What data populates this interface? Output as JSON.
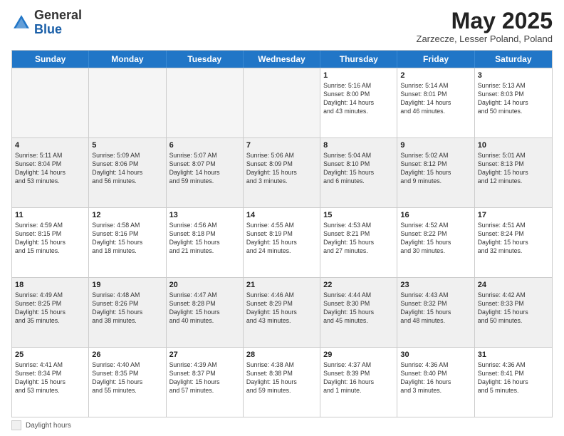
{
  "header": {
    "logo_line1": "General",
    "logo_line2": "Blue",
    "month": "May 2025",
    "location": "Zarzecze, Lesser Poland, Poland"
  },
  "weekdays": [
    "Sunday",
    "Monday",
    "Tuesday",
    "Wednesday",
    "Thursday",
    "Friday",
    "Saturday"
  ],
  "footer": {
    "shaded_label": "Daylight hours"
  },
  "rows": [
    [
      {
        "day": "",
        "text": "",
        "empty": true
      },
      {
        "day": "",
        "text": "",
        "empty": true
      },
      {
        "day": "",
        "text": "",
        "empty": true
      },
      {
        "day": "",
        "text": "",
        "empty": true
      },
      {
        "day": "1",
        "text": "Sunrise: 5:16 AM\nSunset: 8:00 PM\nDaylight: 14 hours\nand 43 minutes.",
        "shaded": false
      },
      {
        "day": "2",
        "text": "Sunrise: 5:14 AM\nSunset: 8:01 PM\nDaylight: 14 hours\nand 46 minutes.",
        "shaded": false
      },
      {
        "day": "3",
        "text": "Sunrise: 5:13 AM\nSunset: 8:03 PM\nDaylight: 14 hours\nand 50 minutes.",
        "shaded": false
      }
    ],
    [
      {
        "day": "4",
        "text": "Sunrise: 5:11 AM\nSunset: 8:04 PM\nDaylight: 14 hours\nand 53 minutes.",
        "shaded": true
      },
      {
        "day": "5",
        "text": "Sunrise: 5:09 AM\nSunset: 8:06 PM\nDaylight: 14 hours\nand 56 minutes.",
        "shaded": true
      },
      {
        "day": "6",
        "text": "Sunrise: 5:07 AM\nSunset: 8:07 PM\nDaylight: 14 hours\nand 59 minutes.",
        "shaded": true
      },
      {
        "day": "7",
        "text": "Sunrise: 5:06 AM\nSunset: 8:09 PM\nDaylight: 15 hours\nand 3 minutes.",
        "shaded": true
      },
      {
        "day": "8",
        "text": "Sunrise: 5:04 AM\nSunset: 8:10 PM\nDaylight: 15 hours\nand 6 minutes.",
        "shaded": true
      },
      {
        "day": "9",
        "text": "Sunrise: 5:02 AM\nSunset: 8:12 PM\nDaylight: 15 hours\nand 9 minutes.",
        "shaded": true
      },
      {
        "day": "10",
        "text": "Sunrise: 5:01 AM\nSunset: 8:13 PM\nDaylight: 15 hours\nand 12 minutes.",
        "shaded": true
      }
    ],
    [
      {
        "day": "11",
        "text": "Sunrise: 4:59 AM\nSunset: 8:15 PM\nDaylight: 15 hours\nand 15 minutes.",
        "shaded": false
      },
      {
        "day": "12",
        "text": "Sunrise: 4:58 AM\nSunset: 8:16 PM\nDaylight: 15 hours\nand 18 minutes.",
        "shaded": false
      },
      {
        "day": "13",
        "text": "Sunrise: 4:56 AM\nSunset: 8:18 PM\nDaylight: 15 hours\nand 21 minutes.",
        "shaded": false
      },
      {
        "day": "14",
        "text": "Sunrise: 4:55 AM\nSunset: 8:19 PM\nDaylight: 15 hours\nand 24 minutes.",
        "shaded": false
      },
      {
        "day": "15",
        "text": "Sunrise: 4:53 AM\nSunset: 8:21 PM\nDaylight: 15 hours\nand 27 minutes.",
        "shaded": false
      },
      {
        "day": "16",
        "text": "Sunrise: 4:52 AM\nSunset: 8:22 PM\nDaylight: 15 hours\nand 30 minutes.",
        "shaded": false
      },
      {
        "day": "17",
        "text": "Sunrise: 4:51 AM\nSunset: 8:24 PM\nDaylight: 15 hours\nand 32 minutes.",
        "shaded": false
      }
    ],
    [
      {
        "day": "18",
        "text": "Sunrise: 4:49 AM\nSunset: 8:25 PM\nDaylight: 15 hours\nand 35 minutes.",
        "shaded": true
      },
      {
        "day": "19",
        "text": "Sunrise: 4:48 AM\nSunset: 8:26 PM\nDaylight: 15 hours\nand 38 minutes.",
        "shaded": true
      },
      {
        "day": "20",
        "text": "Sunrise: 4:47 AM\nSunset: 8:28 PM\nDaylight: 15 hours\nand 40 minutes.",
        "shaded": true
      },
      {
        "day": "21",
        "text": "Sunrise: 4:46 AM\nSunset: 8:29 PM\nDaylight: 15 hours\nand 43 minutes.",
        "shaded": true
      },
      {
        "day": "22",
        "text": "Sunrise: 4:44 AM\nSunset: 8:30 PM\nDaylight: 15 hours\nand 45 minutes.",
        "shaded": true
      },
      {
        "day": "23",
        "text": "Sunrise: 4:43 AM\nSunset: 8:32 PM\nDaylight: 15 hours\nand 48 minutes.",
        "shaded": true
      },
      {
        "day": "24",
        "text": "Sunrise: 4:42 AM\nSunset: 8:33 PM\nDaylight: 15 hours\nand 50 minutes.",
        "shaded": true
      }
    ],
    [
      {
        "day": "25",
        "text": "Sunrise: 4:41 AM\nSunset: 8:34 PM\nDaylight: 15 hours\nand 53 minutes.",
        "shaded": false
      },
      {
        "day": "26",
        "text": "Sunrise: 4:40 AM\nSunset: 8:35 PM\nDaylight: 15 hours\nand 55 minutes.",
        "shaded": false
      },
      {
        "day": "27",
        "text": "Sunrise: 4:39 AM\nSunset: 8:37 PM\nDaylight: 15 hours\nand 57 minutes.",
        "shaded": false
      },
      {
        "day": "28",
        "text": "Sunrise: 4:38 AM\nSunset: 8:38 PM\nDaylight: 15 hours\nand 59 minutes.",
        "shaded": false
      },
      {
        "day": "29",
        "text": "Sunrise: 4:37 AM\nSunset: 8:39 PM\nDaylight: 16 hours\nand 1 minute.",
        "shaded": false
      },
      {
        "day": "30",
        "text": "Sunrise: 4:36 AM\nSunset: 8:40 PM\nDaylight: 16 hours\nand 3 minutes.",
        "shaded": false
      },
      {
        "day": "31",
        "text": "Sunrise: 4:36 AM\nSunset: 8:41 PM\nDaylight: 16 hours\nand 5 minutes.",
        "shaded": false
      }
    ]
  ]
}
